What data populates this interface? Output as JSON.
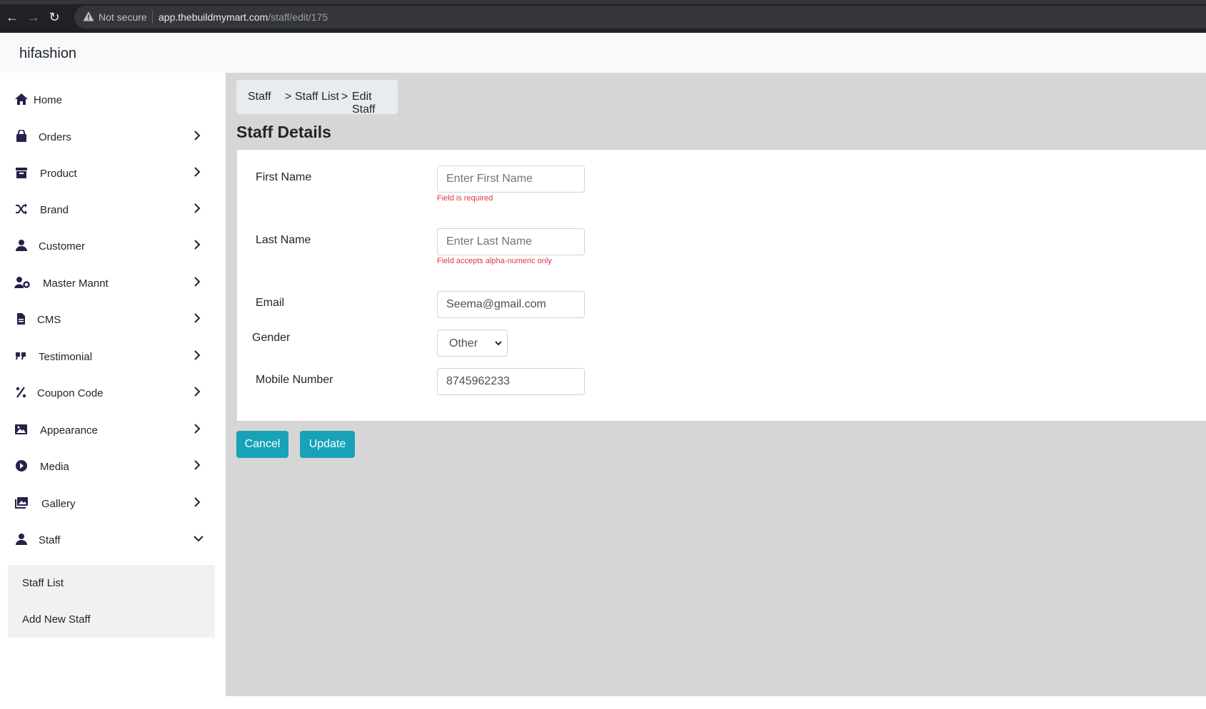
{
  "browser": {
    "security_label": "Not secure",
    "url_host": "app.thebuildmymart.com",
    "url_path": "/staff/edit/175"
  },
  "app": {
    "brand": "hifashion"
  },
  "sidebar": {
    "items": [
      {
        "label": "Home",
        "icon": "home-icon"
      },
      {
        "label": "Orders",
        "icon": "shopping-bag-icon"
      },
      {
        "label": "Product",
        "icon": "archive-box-icon"
      },
      {
        "label": "Brand",
        "icon": "shuffle-icon"
      },
      {
        "label": "Customer",
        "icon": "user-icon"
      },
      {
        "label": "Master Mannt",
        "icon": "user-gear-icon"
      },
      {
        "label": "CMS",
        "icon": "document-icon"
      },
      {
        "label": "Testimonial",
        "icon": "quote-icon"
      },
      {
        "label": "Coupon Code",
        "icon": "percent-icon"
      },
      {
        "label": "Appearance",
        "icon": "image-icon"
      },
      {
        "label": "Media",
        "icon": "play-circle-icon"
      },
      {
        "label": "Gallery",
        "icon": "images-icon"
      },
      {
        "label": "Staff",
        "icon": "user-icon"
      }
    ],
    "staff_submenu": [
      "Staff List",
      "Add New Staff"
    ]
  },
  "breadcrumb": [
    "Staff",
    "Staff List",
    "Edit Staff"
  ],
  "breadcrumb_separator": ">",
  "page_title": "Staff Details",
  "form": {
    "first_name": {
      "label": "First Name",
      "placeholder": "Enter First Name",
      "value": "",
      "error": "Field is required"
    },
    "last_name": {
      "label": "Last Name",
      "placeholder": "Enter Last Name",
      "value": "",
      "error": "Field accepts alpha-numeric only"
    },
    "email": {
      "label": "Email",
      "value": "Seema@gmail.com"
    },
    "gender": {
      "label": "Gender",
      "value": "Other"
    },
    "mobile": {
      "label": "Mobile Number",
      "value": "8745962233"
    }
  },
  "buttons": {
    "cancel": "Cancel",
    "update": "Update"
  },
  "colors": {
    "accent": "#17a2b8",
    "error": "#dc3545",
    "content_bg": "#d6d6d6",
    "icon": "#2a1f4a"
  }
}
